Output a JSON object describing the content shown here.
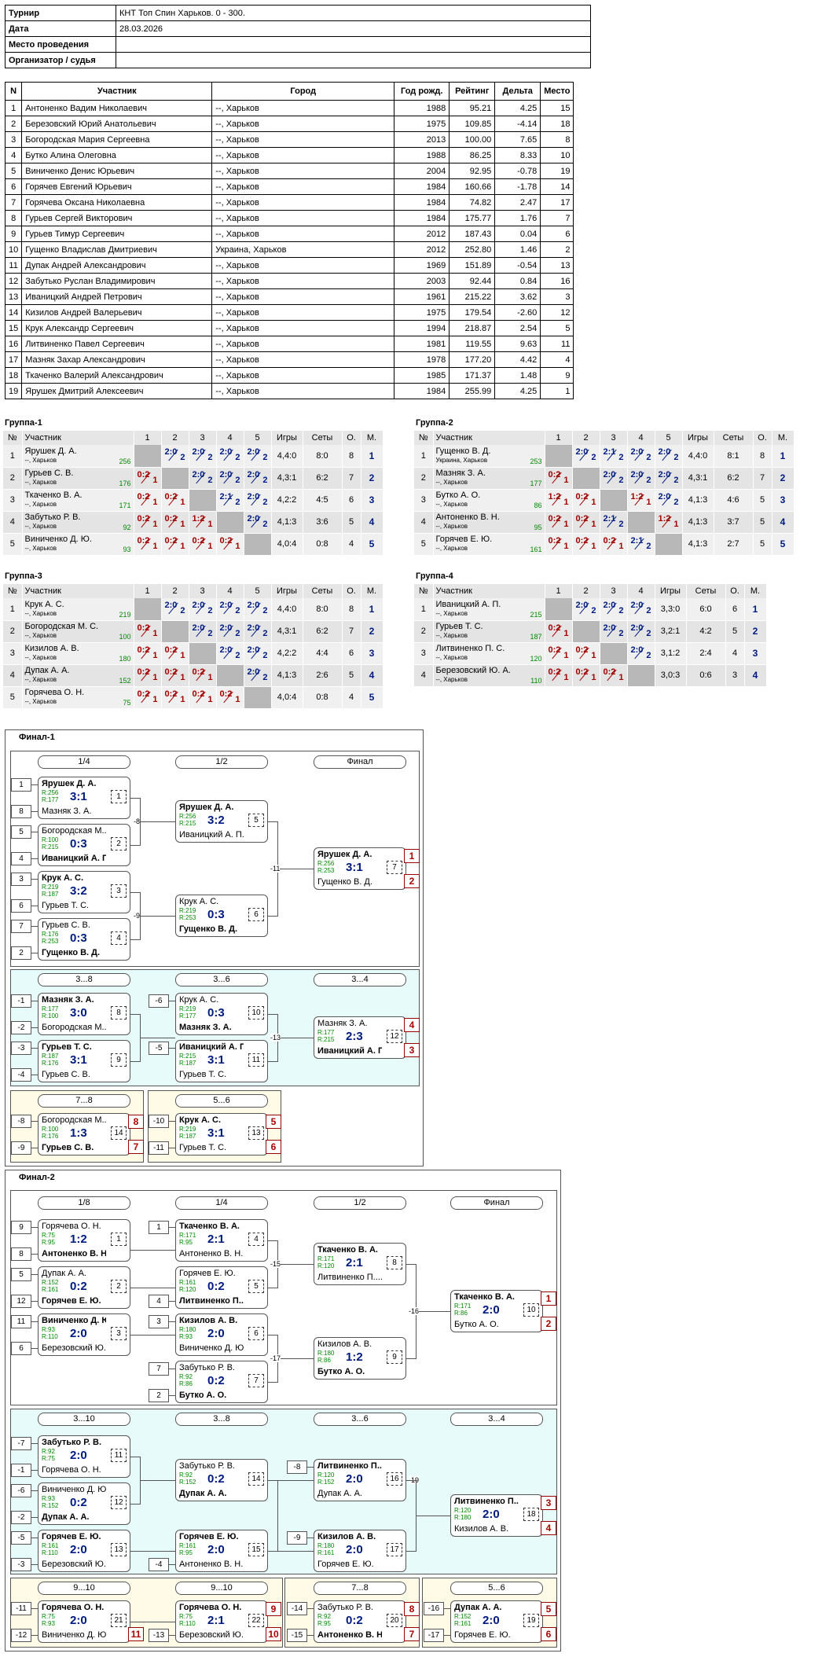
{
  "info": [
    [
      "Турнир",
      "КНТ Топ Спин Харьков. 0 - 300."
    ],
    [
      "Дата",
      "28.03.2026"
    ],
    [
      "Место проведения",
      ""
    ],
    [
      "Организатор / судья",
      ""
    ]
  ],
  "players_header": [
    "N",
    "Участник",
    "Город",
    "Год рожд.",
    "Рейтинг",
    "Дельта",
    "Место"
  ],
  "players": [
    [
      "1",
      "Антоненко Вадим Николаевич",
      "--, Харьков",
      "1988",
      "95.21",
      "4.25",
      "15"
    ],
    [
      "2",
      "Березовский Юрий Анатольевич",
      "--, Харьков",
      "1975",
      "109.85",
      "-4.14",
      "18"
    ],
    [
      "3",
      "Богородская Мария Сергеевна",
      "--, Харьков",
      "2013",
      "100.00",
      "7.65",
      "8"
    ],
    [
      "4",
      "Бутко Алина Олеговна",
      "--, Харьков",
      "1988",
      "86.25",
      "8.33",
      "10"
    ],
    [
      "5",
      "Виниченко Денис Юрьевич",
      "--, Харьков",
      "2004",
      "92.95",
      "-0.78",
      "19"
    ],
    [
      "6",
      "Горячев Евгений Юрьевич",
      "--, Харьков",
      "1984",
      "160.66",
      "-1.78",
      "14"
    ],
    [
      "7",
      "Горячева Оксана Николаевна",
      "--, Харьков",
      "1984",
      "74.82",
      "2.47",
      "17"
    ],
    [
      "8",
      "Гурьев Сергей Викторович",
      "--, Харьков",
      "1984",
      "175.77",
      "1.76",
      "7"
    ],
    [
      "9",
      "Гурьев Тимур Сергеевич",
      "--, Харьков",
      "2012",
      "187.43",
      "0.04",
      "6"
    ],
    [
      "10",
      "Гущенко Владислав Дмитриевич",
      "Украина, Харьков",
      "2012",
      "252.80",
      "1.46",
      "2"
    ],
    [
      "11",
      "Дупак Андрей Александрович",
      "--, Харьков",
      "1969",
      "151.89",
      "-0.54",
      "13"
    ],
    [
      "12",
      "Забутько Руслан Владимирович",
      "--, Харьков",
      "2003",
      "92.44",
      "0.84",
      "16"
    ],
    [
      "13",
      "Иваницкий Андрей Петрович",
      "--, Харьков",
      "1961",
      "215.22",
      "3.62",
      "3"
    ],
    [
      "14",
      "Кизилов Андрей Валерьевич",
      "--, Харьков",
      "1975",
      "179.54",
      "-2.60",
      "12"
    ],
    [
      "15",
      "Крук Александр Сергеевич",
      "--, Харьков",
      "1994",
      "218.87",
      "2.54",
      "5"
    ],
    [
      "16",
      "Литвиненко Павел Сергеевич",
      "--, Харьков",
      "1981",
      "119.55",
      "9.63",
      "11"
    ],
    [
      "17",
      "Мазняк Захар Александрович",
      "--, Харьков",
      "1978",
      "177.20",
      "4.42",
      "4"
    ],
    [
      "18",
      "Ткаченко Валерий Александрович",
      "--, Харьков",
      "1985",
      "171.37",
      "1.48",
      "9"
    ],
    [
      "19",
      "Ярушек Дмитрий Алексеевич",
      "--, Харьков",
      "1984",
      "255.99",
      "4.25",
      "1"
    ]
  ],
  "group_header": [
    "№",
    "Участник",
    "1",
    "2",
    "3",
    "4",
    "5",
    "Игры",
    "Сеты",
    "О.",
    "М."
  ],
  "groups": [
    {
      "title": "Группа-1",
      "rows": [
        {
          "n": "1",
          "name": "Ярушек Д. А.",
          "city": "--, Харьков",
          "r": "256",
          "cells": [
            "x",
            "2:0|2",
            "2:0|2",
            "2:0|2",
            "2:0|2"
          ],
          "games": "4,4:0",
          "sets": "8:0",
          "pts": "8",
          "place": "1"
        },
        {
          "n": "2",
          "name": "Гурьев С. В.",
          "city": "--, Харьков",
          "r": "176",
          "cells": [
            "0:2|1",
            "x",
            "2:0|2",
            "2:0|2",
            "2:0|2"
          ],
          "games": "4,3:1",
          "sets": "6:2",
          "pts": "7",
          "place": "2"
        },
        {
          "n": "3",
          "name": "Ткаченко В. А.",
          "city": "--, Харьков",
          "r": "171",
          "cells": [
            "0:2|1",
            "0:2|1",
            "x",
            "2:1|2",
            "2:0|2"
          ],
          "games": "4,2:2",
          "sets": "4:5",
          "pts": "6",
          "place": "3"
        },
        {
          "n": "4",
          "name": "Забутько Р. В.",
          "city": "--, Харьков",
          "r": "92",
          "cells": [
            "0:2|1",
            "0:2|1",
            "1:2|1",
            "x",
            "2:0|2"
          ],
          "games": "4,1:3",
          "sets": "3:6",
          "pts": "5",
          "place": "4"
        },
        {
          "n": "5",
          "name": "Виниченко Д. Ю.",
          "city": "--, Харьков",
          "r": "93",
          "cells": [
            "0:2|1",
            "0:2|1",
            "0:2|1",
            "0:2|1",
            "x"
          ],
          "games": "4,0:4",
          "sets": "0:8",
          "pts": "4",
          "place": "5"
        }
      ]
    },
    {
      "title": "Группа-2",
      "rows": [
        {
          "n": "1",
          "name": "Гущенко В. Д.",
          "city": "Украина, Харьков",
          "r": "253",
          "cells": [
            "x",
            "2:0|2",
            "2:1|2",
            "2:0|2",
            "2:0|2"
          ],
          "games": "4,4:0",
          "sets": "8:1",
          "pts": "8",
          "place": "1"
        },
        {
          "n": "2",
          "name": "Мазняк З. А.",
          "city": "--, Харьков",
          "r": "177",
          "cells": [
            "0:2|1",
            "x",
            "2:0|2",
            "2:0|2",
            "2:0|2"
          ],
          "games": "4,3:1",
          "sets": "6:2",
          "pts": "7",
          "place": "2"
        },
        {
          "n": "3",
          "name": "Бутко А. О.",
          "city": "--, Харьков",
          "r": "86",
          "cells": [
            "1:2|1",
            "0:2|1",
            "x",
            "1:2|1",
            "2:0|2"
          ],
          "games": "4,1:3",
          "sets": "4:6",
          "pts": "5",
          "place": "3"
        },
        {
          "n": "4",
          "name": "Антоненко В. Н.",
          "city": "--, Харьков",
          "r": "95",
          "cells": [
            "0:2|1",
            "0:2|1",
            "2:1|2",
            "x",
            "1:2|1"
          ],
          "games": "4,1:3",
          "sets": "3:7",
          "pts": "5",
          "place": "4"
        },
        {
          "n": "5",
          "name": "Горячев Е. Ю.",
          "city": "--, Харьков",
          "r": "161",
          "cells": [
            "0:2|1",
            "0:2|1",
            "0:2|1",
            "2:1|2",
            "x"
          ],
          "games": "4,1:3",
          "sets": "2:7",
          "pts": "5",
          "place": "5"
        }
      ]
    },
    {
      "title": "Группа-3",
      "rows": [
        {
          "n": "1",
          "name": "Крук А. С.",
          "city": "--, Харьков",
          "r": "219",
          "cells": [
            "x",
            "2:0|2",
            "2:0|2",
            "2:0|2",
            "2:0|2"
          ],
          "games": "4,4:0",
          "sets": "8:0",
          "pts": "8",
          "place": "1"
        },
        {
          "n": "2",
          "name": "Богородская М. С.",
          "city": "--, Харьков",
          "r": "100",
          "cells": [
            "0:2|1",
            "x",
            "2:0|2",
            "2:0|2",
            "2:0|2"
          ],
          "games": "4,3:1",
          "sets": "6:2",
          "pts": "7",
          "place": "2"
        },
        {
          "n": "3",
          "name": "Кизилов А. В.",
          "city": "--, Харьков",
          "r": "180",
          "cells": [
            "0:2|1",
            "0:2|1",
            "x",
            "2:0|2",
            "2:0|2"
          ],
          "games": "4,2:2",
          "sets": "4:4",
          "pts": "6",
          "place": "3"
        },
        {
          "n": "4",
          "name": "Дупак А. А.",
          "city": "--, Харьков",
          "r": "152",
          "cells": [
            "0:2|1",
            "0:2|1",
            "0:2|1",
            "x",
            "2:0|2"
          ],
          "games": "4,1:3",
          "sets": "2:6",
          "pts": "5",
          "place": "4"
        },
        {
          "n": "5",
          "name": "Горячева О. Н.",
          "city": "--, Харьков",
          "r": "75",
          "cells": [
            "0:2|1",
            "0:2|1",
            "0:2|1",
            "0:2|1",
            "x"
          ],
          "games": "4,0:4",
          "sets": "0:8",
          "pts": "4",
          "place": "5"
        }
      ]
    },
    {
      "title": "Группа-4",
      "rows": [
        {
          "n": "1",
          "name": "Иваницкий А. П.",
          "city": "--, Харьков",
          "r": "215",
          "cells": [
            "x",
            "2:0|2",
            "2:0|2",
            "2:0|2"
          ],
          "games": "3,3:0",
          "sets": "6:0",
          "pts": "6",
          "place": "1"
        },
        {
          "n": "2",
          "name": "Гурьев Т. С.",
          "city": "--, Харьков",
          "r": "187",
          "cells": [
            "0:2|1",
            "x",
            "2:0|2",
            "2:0|2"
          ],
          "games": "3,2:1",
          "sets": "4:2",
          "pts": "5",
          "place": "2"
        },
        {
          "n": "3",
          "name": "Литвиненко П. С.",
          "city": "--, Харьков",
          "r": "120",
          "cells": [
            "0:2|1",
            "0:2|1",
            "x",
            "2:0|2"
          ],
          "games": "3,1:2",
          "sets": "2:4",
          "pts": "4",
          "place": "3"
        },
        {
          "n": "4",
          "name": "Березовский Ю. А.",
          "city": "--, Харьков",
          "r": "110",
          "cells": [
            "0:2|1",
            "0:2|1",
            "0:2|1",
            "x"
          ],
          "games": "3,0:3",
          "sets": "0:6",
          "pts": "3",
          "place": "4"
        }
      ]
    }
  ],
  "final1": {
    "title": "Финал-1",
    "phases": [
      "1/4",
      "1/2",
      "Финал",
      "3...8",
      "3...6",
      "3...4",
      "7...8",
      "5...6"
    ],
    "matches": [
      {
        "p1": "Ярушек Д. А.",
        "r1": "R:256",
        "p2": "Мазняк З. А.",
        "r2": "R:177",
        "s": "3:1",
        "m": "1",
        "w": 1,
        "seed1": "1",
        "seed2": "8",
        "ref": "-8"
      },
      {
        "p1": "Богородская М...",
        "r1": "R:100",
        "p2": "Иваницкий А. П.",
        "r2": "R:215",
        "s": "0:3",
        "m": "2",
        "w": 2,
        "seed1": "5",
        "seed2": "4",
        "ref": "-8"
      },
      {
        "p1": "Крук А. С.",
        "r1": "R:219",
        "p2": "Гурьев Т. С.",
        "r2": "R:187",
        "s": "3:2",
        "m": "3",
        "w": 1,
        "seed1": "3",
        "seed2": "6",
        "ref": "-9"
      },
      {
        "p1": "Гурьев С. В.",
        "r1": "R:176",
        "p2": "Гущенко В. Д.",
        "r2": "R:253",
        "s": "0:3",
        "m": "4",
        "w": 2,
        "seed1": "7",
        "seed2": "2",
        "ref": "-9"
      },
      {
        "p1": "Ярушек Д. А.",
        "r1": "R:256",
        "p2": "Иваницкий А. П.",
        "r2": "R:215",
        "s": "3:2",
        "m": "5",
        "w": 1,
        "ref": "-11"
      },
      {
        "p1": "Крук А. С.",
        "r1": "R:219",
        "p2": "Гущенко В. Д.",
        "r2": "R:253",
        "s": "0:3",
        "m": "6",
        "w": 2,
        "ref": "-10"
      },
      {
        "p1": "Ярушек Д. А.",
        "r1": "R:256",
        "p2": "Гущенко В. Д.",
        "r2": "R:253",
        "s": "3:1",
        "m": "7",
        "w": 1,
        "pl1": "1",
        "pl2": "2"
      },
      {
        "p1": "Мазняк З. А.",
        "r1": "R:177",
        "p2": "Богородская М...",
        "r2": "R:100",
        "s": "3:0",
        "m": "8",
        "w": 1,
        "seed1": "-1",
        "seed2": "-2",
        "ref": "-14"
      },
      {
        "p1": "Гурьев Т. С.",
        "r1": "R:187",
        "p2": "Гурьев С. В.",
        "r2": "R:176",
        "s": "3:1",
        "m": "9",
        "w": 1,
        "seed1": "-3",
        "seed2": "-4",
        "ref": "-14"
      },
      {
        "p1": "Крук А. С.",
        "r1": "R:219",
        "p2": "Мазняк З. А.",
        "r2": "R:177",
        "s": "0:3",
        "m": "10",
        "w": 2,
        "seed1": "-6",
        "ref": "-13"
      },
      {
        "p1": "Иваницкий А. П.",
        "r1": "R:215",
        "p2": "Гурьев Т. С.",
        "r2": "R:187",
        "s": "3:1",
        "m": "11",
        "w": 1,
        "seed1": "-5",
        "ref": "-13"
      },
      {
        "p1": "Мазняк З. А.",
        "r1": "R:177",
        "p2": "Иваницкий А. П.",
        "r2": "R:215",
        "s": "2:3",
        "m": "12",
        "w": 2,
        "pl1": "4",
        "pl2": "3"
      },
      {
        "p1": "Богородская М...",
        "r1": "R:100",
        "p2": "Гурьев С. В.",
        "r2": "R:176",
        "s": "1:3",
        "m": "14",
        "w": 2,
        "seed1": "-8",
        "seed2": "-9",
        "pl1": "8",
        "pl2": "7"
      },
      {
        "p1": "Крук А. С.",
        "r1": "R:219",
        "p2": "Гурьев Т. С.",
        "r2": "R:187",
        "s": "3:1",
        "m": "13",
        "w": 1,
        "seed1": "-10",
        "seed2": "-11",
        "pl1": "5",
        "pl2": "6"
      }
    ]
  },
  "final2": {
    "title": "Финал-2",
    "phases": [
      "1/8",
      "1/4",
      "1/2",
      "Финал",
      "3...10",
      "3...8",
      "3...6",
      "3...4",
      "9...10",
      "9...10",
      "7...8",
      "5...6"
    ],
    "matches": [
      {
        "p1": "Горячева О. Н.",
        "r1": "R:75",
        "p2": "Антоненко В. Н.",
        "r2": "R:95",
        "s": "1:2",
        "m": "1",
        "w": 2,
        "seed1": "9",
        "seed2": "8",
        "ref": "-11"
      },
      {
        "p1": "Дупак А. А.",
        "r1": "R:152",
        "p2": "Горячев Е. Ю.",
        "r2": "R:161",
        "s": "0:2",
        "m": "2",
        "w": 2,
        "seed1": "5",
        "seed2": "12",
        "ref": "-12"
      },
      {
        "p1": "Виниченко Д. Ю.",
        "r1": "R:93",
        "p2": "Березовский Ю...",
        "r2": "R:110",
        "s": "2:0",
        "m": "3",
        "w": 1,
        "seed1": "11",
        "seed2": "6",
        "ref": "-13"
      },
      {
        "p1": "Ткаченко В. А.",
        "r1": "R:171",
        "p2": "Антоненко В. Н.",
        "r2": "R:95",
        "s": "2:1",
        "m": "4",
        "w": 1,
        "seed1": "1",
        "ref": "-15"
      },
      {
        "p1": "Горячев Е. Ю.",
        "r1": "R:161",
        "p2": "Литвиненко П....",
        "r2": "R:120",
        "s": "0:2",
        "m": "5",
        "w": 2,
        "seed2": "4",
        "ref": "-13"
      },
      {
        "p1": "Кизилов А. В.",
        "r1": "R:180",
        "p2": "Виниченко Д. Ю.",
        "r2": "R:93",
        "s": "2:0",
        "m": "6",
        "w": 1,
        "seed1": "3",
        "ref": "-12"
      },
      {
        "p1": "Забутько Р. В.",
        "r1": "R:92",
        "p2": "Бутко А. О.",
        "r2": "R:86",
        "s": "0:2",
        "m": "7",
        "w": 2,
        "seed1": "7",
        "seed2": "2",
        "ref": "-11"
      },
      {
        "p1": "Ткаченко В. А.",
        "r1": "R:171",
        "p2": "Литвиненко П....",
        "r2": "R:120",
        "s": "2:1",
        "m": "8",
        "w": 1,
        "ref": "-16"
      },
      {
        "p1": "Кизилов А. В.",
        "r1": "R:180",
        "p2": "Бутко А. О.",
        "r2": "R:86",
        "s": "1:2",
        "m": "9",
        "w": 2,
        "ref": "-17"
      },
      {
        "p1": "Ткаченко В. А.",
        "r1": "R:171",
        "p2": "Бутко А. О.",
        "r2": "R:86",
        "s": "2:0",
        "m": "10",
        "w": 1,
        "pl1": "1",
        "pl2": "2"
      },
      {
        "p1": "Забутько Р. В.",
        "r1": "R:92",
        "p2": "Горячева О. Н.",
        "r2": "R:75",
        "s": "2:0",
        "m": "11",
        "w": 1,
        "seed1": "-7",
        "seed2": "-1",
        "ref": "-21"
      },
      {
        "p1": "Виниченко Д. Ю.",
        "r1": "R:93",
        "p2": "Дупак А. А.",
        "r2": "R:152",
        "s": "0:2",
        "m": "12",
        "w": 2,
        "seed1": "-6",
        "seed2": "-2",
        "ref": "-21"
      },
      {
        "p1": "Горячев Е. Ю.",
        "r1": "R:161",
        "p2": "Березовский Ю...",
        "r2": "R:110",
        "s": "2:0",
        "m": "13",
        "w": 1,
        "seed1": "-5",
        "seed2": "-3",
        "ref": "-22"
      },
      {
        "p1": "Забутько Р. В.",
        "r1": "R:92",
        "p2": "Дупак А. А.",
        "r2": "R:152",
        "s": "0:2",
        "m": "14",
        "w": 2,
        "ref": "-20"
      },
      {
        "p1": "Горячев Е. Ю.",
        "r1": "R:161",
        "p2": "Антоненко В. Н.",
        "r2": "R:95",
        "s": "2:0",
        "m": "15",
        "w": 1,
        "seed2": "-4",
        "ref": "-20"
      },
      {
        "p1": "Литвиненко П....",
        "r1": "R:120",
        "p2": "Дупак А. А.",
        "r2": "R:152",
        "s": "2:0",
        "m": "16",
        "w": 1,
        "seed1": "-8",
        "ref": "-19"
      },
      {
        "p1": "Кизилов А. В.",
        "r1": "R:180",
        "p2": "Горячев Е. Ю.",
        "r2": "R:161",
        "s": "2:0",
        "m": "17",
        "w": 1,
        "seed1": "-9",
        "ref": "-19"
      },
      {
        "p1": "Литвиненко П....",
        "r1": "R:120",
        "p2": "Кизилов А. В.",
        "r2": "R:180",
        "s": "2:0",
        "m": "18",
        "w": 1,
        "pl1": "3",
        "pl2": "4"
      },
      {
        "p1": "Горячева О. Н.",
        "r1": "R:75",
        "p2": "Виниченко Д. Ю.",
        "r2": "R:93",
        "s": "2:0",
        "m": "21",
        "w": 1,
        "seed1": "-11",
        "seed2": "-12",
        "pl2": "11"
      },
      {
        "p1": "Горячева О. Н.",
        "r1": "R:75",
        "p2": "Березовский Ю...",
        "r2": "R:110",
        "s": "2:1",
        "m": "22",
        "w": 1,
        "seed2": "-13",
        "pl1": "9",
        "pl2": "10"
      },
      {
        "p1": "Забутько Р. В.",
        "r1": "R:92",
        "p2": "Антоненко В. Н.",
        "r2": "R:95",
        "s": "0:2",
        "m": "20",
        "w": 2,
        "seed1": "-14",
        "seed2": "-15",
        "pl1": "8",
        "pl2": "7"
      },
      {
        "p1": "Дупак А. А.",
        "r1": "R:152",
        "p2": "Горячев Е. Ю.",
        "r2": "R:161",
        "s": "2:0",
        "m": "19",
        "w": 1,
        "seed1": "-16",
        "seed2": "-17",
        "pl1": "5",
        "pl2": "6"
      }
    ]
  }
}
